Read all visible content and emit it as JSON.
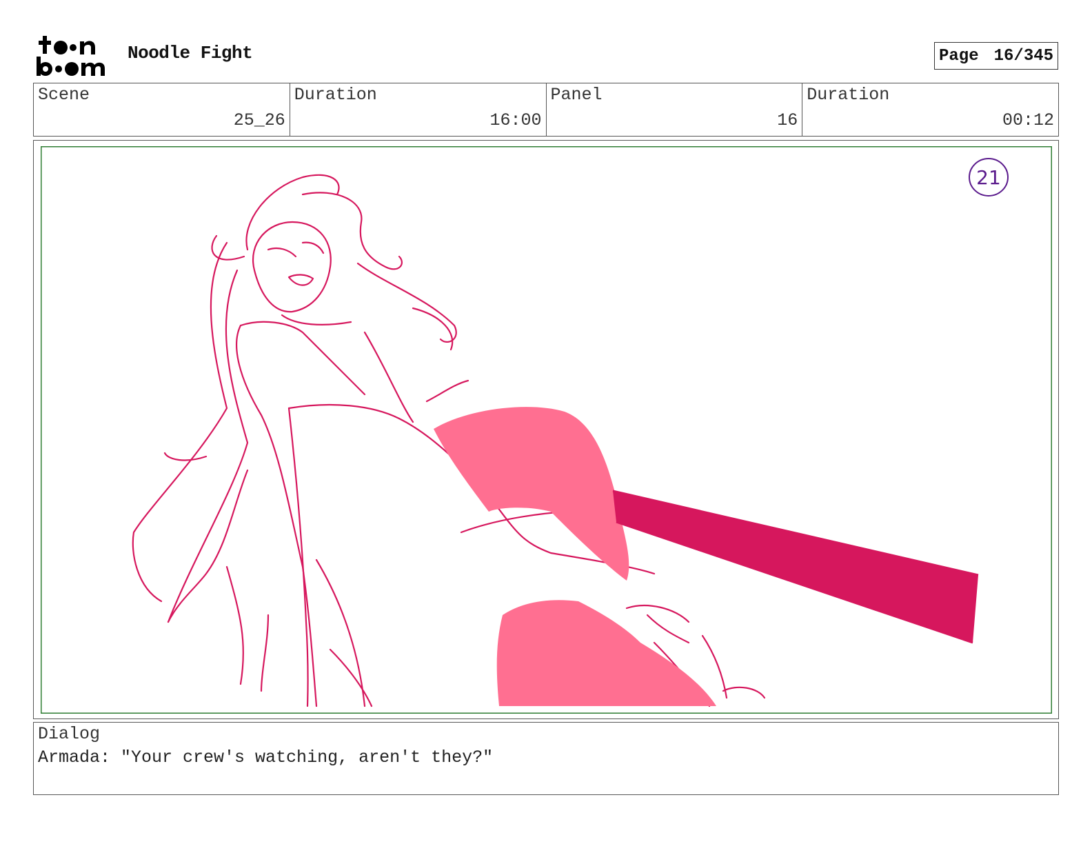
{
  "header": {
    "logo_text_top": "toon",
    "logo_text_bottom": "boom",
    "project_title": "Noodle Fight",
    "page_label": "Page",
    "page_value": "16/345"
  },
  "info": {
    "scene_label": "Scene",
    "scene_value": "25_26",
    "scene_duration_label": "Duration",
    "scene_duration_value": "16:00",
    "panel_label": "Panel",
    "panel_value": "16",
    "panel_duration_label": "Duration",
    "panel_duration_value": "00:12"
  },
  "panel": {
    "drawing_number": "21",
    "frame_color": "#2e7d32",
    "line_color": "#d6175d",
    "fill_color": "#ff6f91",
    "number_color": "#5a1a8c"
  },
  "dialog": {
    "label": "Dialog",
    "text": "Armada: \"Your crew's watching, aren't they?\""
  }
}
